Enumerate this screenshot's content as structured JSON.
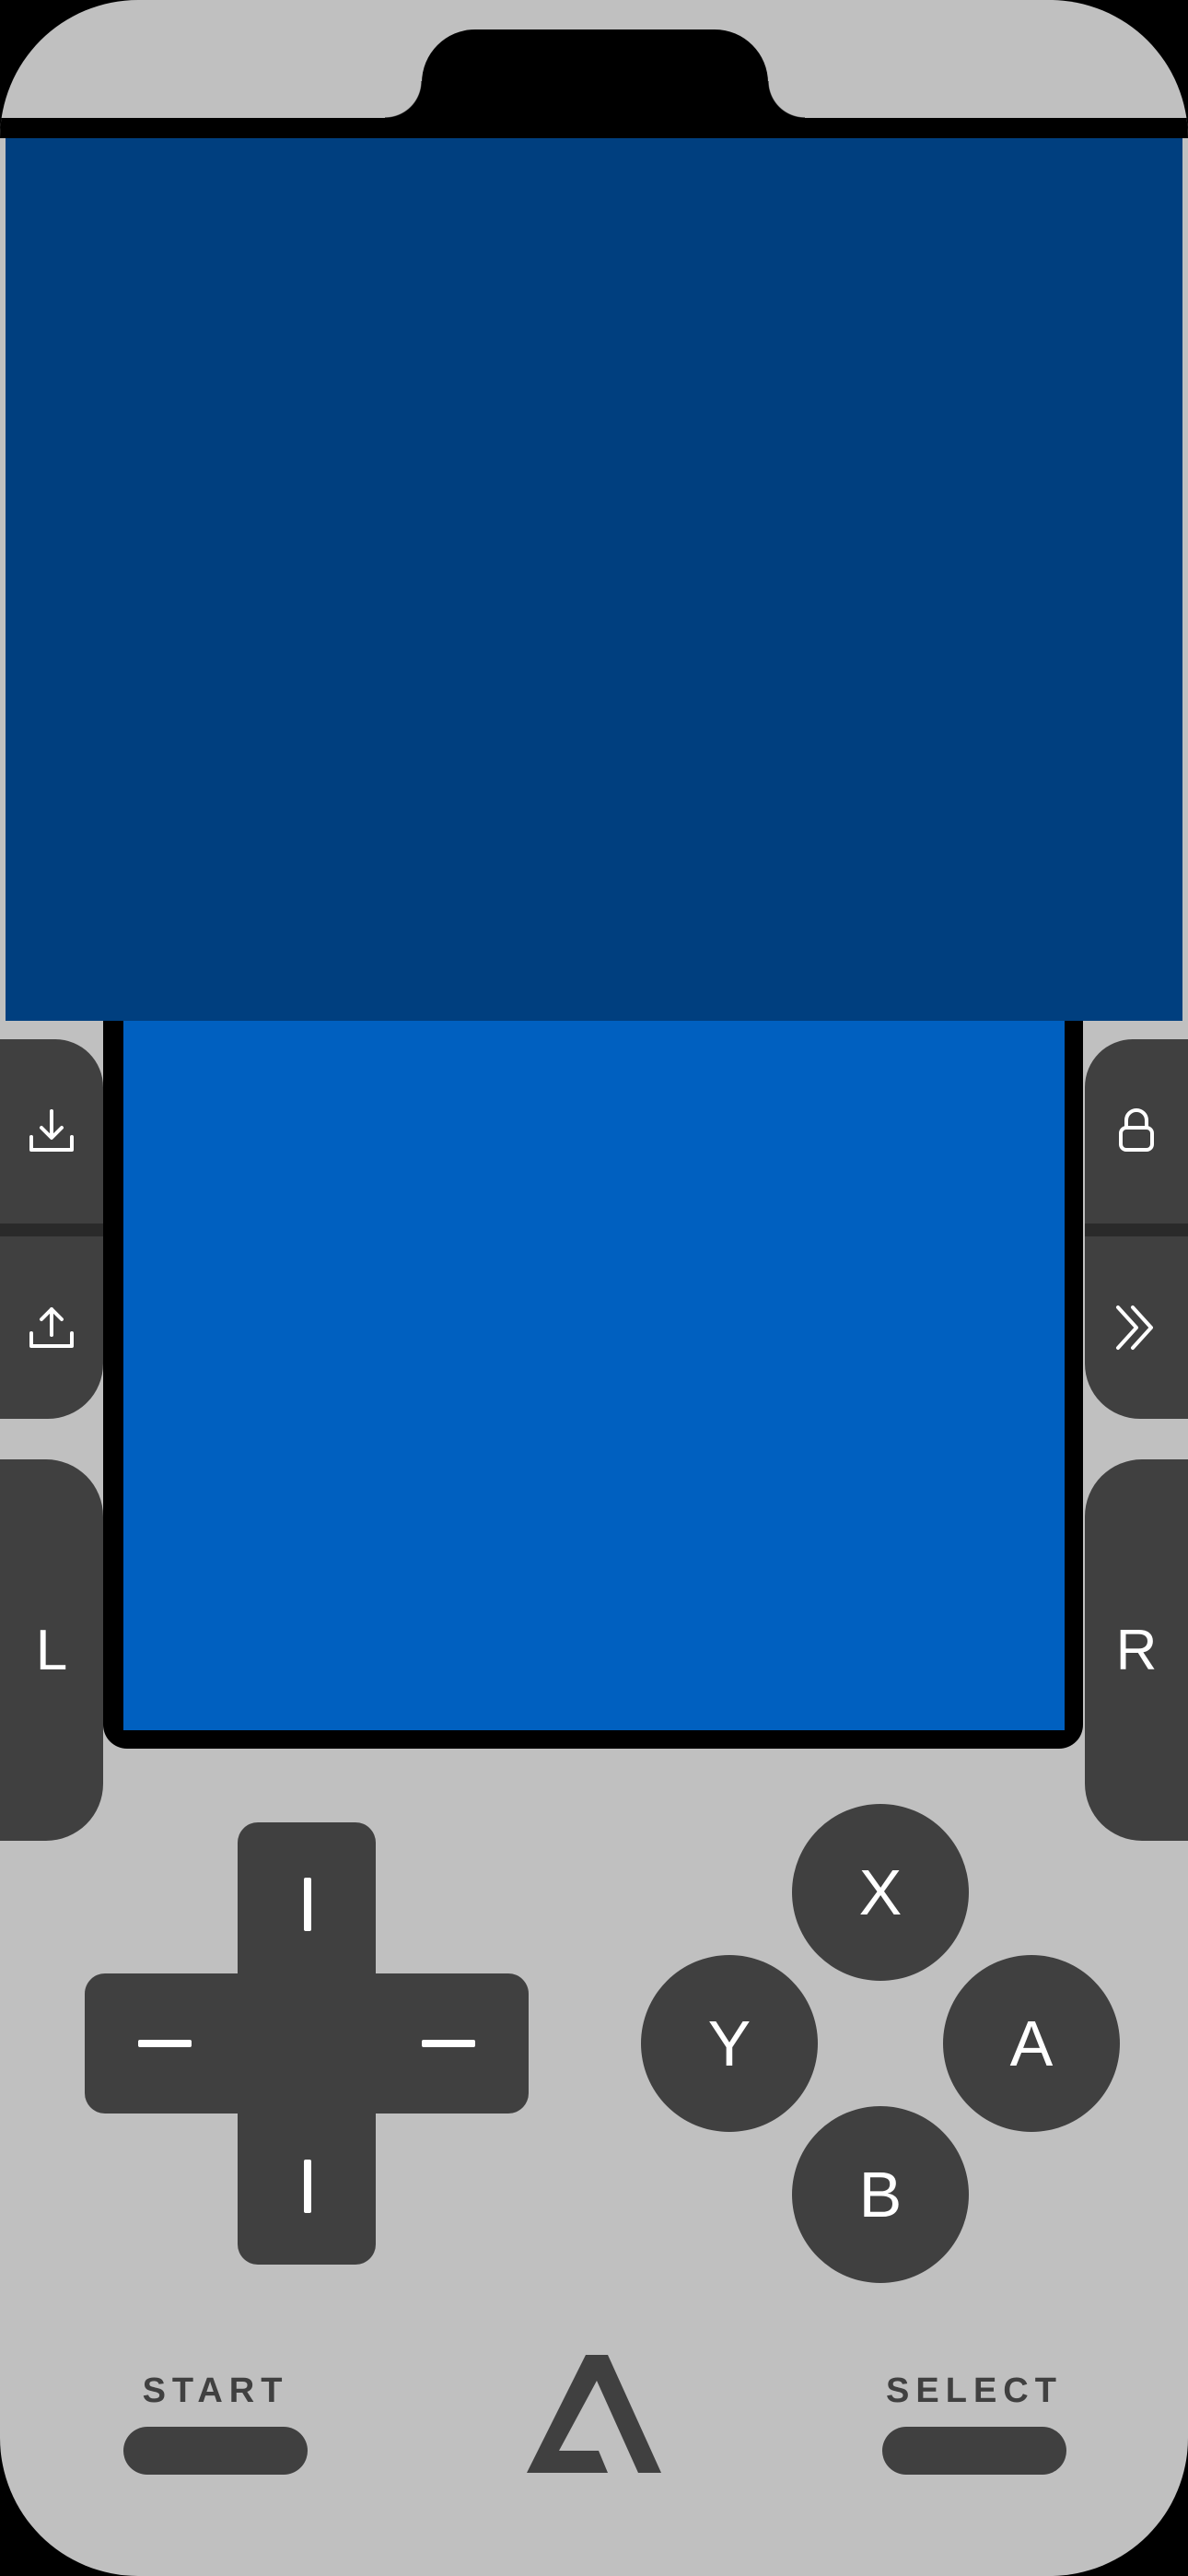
{
  "screens": {
    "top_color": "#003f7f",
    "bottom_color": "#0060c0"
  },
  "left_controls": {
    "save_state_icon": "download-icon",
    "load_state_icon": "upload-icon",
    "l_label": "L"
  },
  "right_controls": {
    "lock_icon": "lock-icon",
    "fast_forward_icon": "fast-forward-icon",
    "r_label": "R"
  },
  "face_buttons": {
    "x": "X",
    "y": "Y",
    "a": "A",
    "b": "B"
  },
  "bottom_bar": {
    "start_label": "START",
    "select_label": "SELECT",
    "logo_icon": "app-logo-icon"
  },
  "colors": {
    "body": "#c0c0c0",
    "button": "#404040",
    "glyph": "#ffffff"
  }
}
